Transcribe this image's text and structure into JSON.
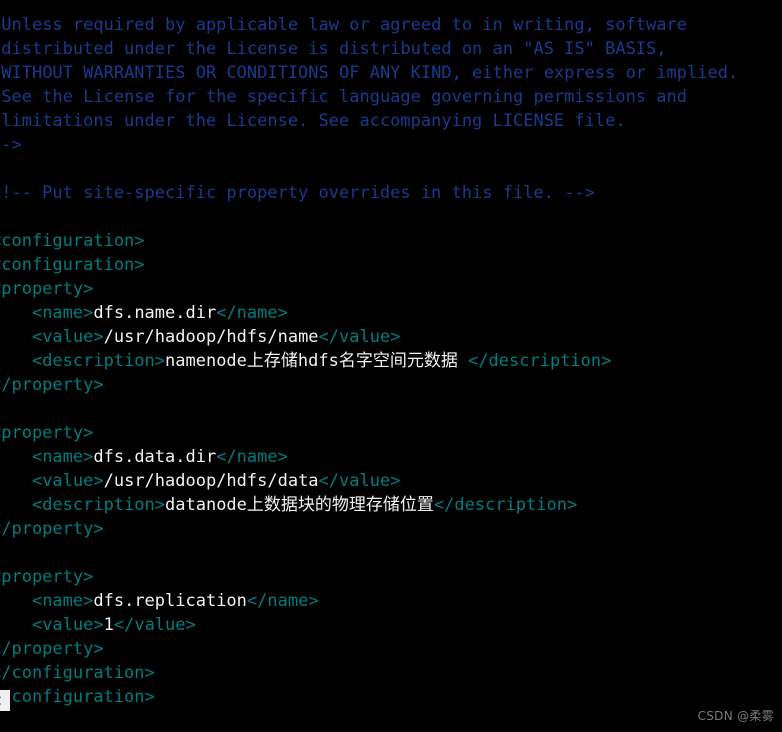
{
  "editor": {
    "background": "#000000",
    "comment_color": "#1a3a8f",
    "tag_color": "#007d7d",
    "text_color": "#f2f2f2",
    "cursor_color": "#f0f0f0",
    "font_size_px": 17,
    "line_height_px": 24
  },
  "lines": [
    {
      "indent": " ",
      "segments": [
        {
          "style": "cmt",
          "text": "Unless required by applicable law or agreed to in writing, software"
        }
      ]
    },
    {
      "indent": " ",
      "segments": [
        {
          "style": "cmt",
          "text": "distributed under the License is distributed on an \"AS IS\" BASIS,"
        }
      ]
    },
    {
      "indent": " ",
      "segments": [
        {
          "style": "cmt",
          "text": "WITHOUT WARRANTIES OR CONDITIONS OF ANY KIND, either express or implied."
        }
      ]
    },
    {
      "indent": " ",
      "segments": [
        {
          "style": "cmt",
          "text": "See the License for the specific language governing permissions and"
        }
      ]
    },
    {
      "indent": " ",
      "segments": [
        {
          "style": "cmt",
          "text": "limitations under the License. See accompanying LICENSE file."
        }
      ]
    },
    {
      "indent": "",
      "segments": [
        {
          "style": "cmt",
          "text": "-->"
        }
      ]
    },
    {
      "indent": "",
      "segments": [
        {
          "style": "blank",
          "text": ""
        }
      ]
    },
    {
      "indent": "",
      "segments": [
        {
          "style": "cmt",
          "text": "<!-- Put site-specific property overrides in this file. -->"
        }
      ]
    },
    {
      "indent": "",
      "segments": [
        {
          "style": "blank",
          "text": ""
        }
      ]
    },
    {
      "indent": "",
      "segments": [
        {
          "style": "tag",
          "text": "<configuration>"
        }
      ]
    },
    {
      "indent": "",
      "segments": [
        {
          "style": "tag",
          "text": "<configuration>"
        }
      ]
    },
    {
      "indent": "",
      "segments": [
        {
          "style": "tag",
          "text": "<property>"
        }
      ]
    },
    {
      "indent": "    ",
      "segments": [
        {
          "style": "tag",
          "text": "<name>"
        },
        {
          "style": "txt",
          "text": "dfs.name.dir"
        },
        {
          "style": "tag",
          "text": "</name>"
        }
      ]
    },
    {
      "indent": "    ",
      "segments": [
        {
          "style": "tag",
          "text": "<value>"
        },
        {
          "style": "txt",
          "text": "/usr/hadoop/hdfs/name"
        },
        {
          "style": "tag",
          "text": "</value>"
        }
      ]
    },
    {
      "indent": "    ",
      "segments": [
        {
          "style": "tag",
          "text": "<description>"
        },
        {
          "style": "txt",
          "text": "namenode上存储hdfs名字空间元数据 "
        },
        {
          "style": "tag",
          "text": "</description>"
        }
      ]
    },
    {
      "indent": "",
      "segments": [
        {
          "style": "tag",
          "text": "</property>"
        }
      ]
    },
    {
      "indent": "",
      "segments": [
        {
          "style": "blank",
          "text": ""
        }
      ]
    },
    {
      "indent": "",
      "segments": [
        {
          "style": "tag",
          "text": "<property>"
        }
      ]
    },
    {
      "indent": "    ",
      "segments": [
        {
          "style": "tag",
          "text": "<name>"
        },
        {
          "style": "txt",
          "text": "dfs.data.dir"
        },
        {
          "style": "tag",
          "text": "</name>"
        }
      ]
    },
    {
      "indent": "    ",
      "segments": [
        {
          "style": "tag",
          "text": "<value>"
        },
        {
          "style": "txt",
          "text": "/usr/hadoop/hdfs/data"
        },
        {
          "style": "tag",
          "text": "</value>"
        }
      ]
    },
    {
      "indent": "    ",
      "segments": [
        {
          "style": "tag",
          "text": "<description>"
        },
        {
          "style": "txt",
          "text": "datanode上数据块的物理存储位置"
        },
        {
          "style": "tag",
          "text": "</description>"
        }
      ]
    },
    {
      "indent": "",
      "segments": [
        {
          "style": "tag",
          "text": "</property>"
        }
      ]
    },
    {
      "indent": "",
      "segments": [
        {
          "style": "blank",
          "text": ""
        }
      ]
    },
    {
      "indent": "",
      "segments": [
        {
          "style": "tag",
          "text": "<property>"
        }
      ]
    },
    {
      "indent": "    ",
      "segments": [
        {
          "style": "tag",
          "text": "<name>"
        },
        {
          "style": "txt",
          "text": "dfs.replication"
        },
        {
          "style": "tag",
          "text": "</name>"
        }
      ]
    },
    {
      "indent": "    ",
      "segments": [
        {
          "style": "tag",
          "text": "<value>"
        },
        {
          "style": "txt",
          "text": "1"
        },
        {
          "style": "tag",
          "text": "</value>"
        }
      ]
    },
    {
      "indent": "",
      "segments": [
        {
          "style": "tag",
          "text": "</property>"
        }
      ]
    },
    {
      "indent": "",
      "segments": [
        {
          "style": "tag",
          "text": "</configuration>"
        }
      ]
    },
    {
      "indent": "",
      "segments": [
        {
          "style": "tag",
          "text": "</configuration>"
        }
      ]
    }
  ],
  "cursor": {
    "glyph": "<",
    "line_index": 29,
    "column": 0
  },
  "watermark": {
    "text": "CSDN @柔雾"
  }
}
